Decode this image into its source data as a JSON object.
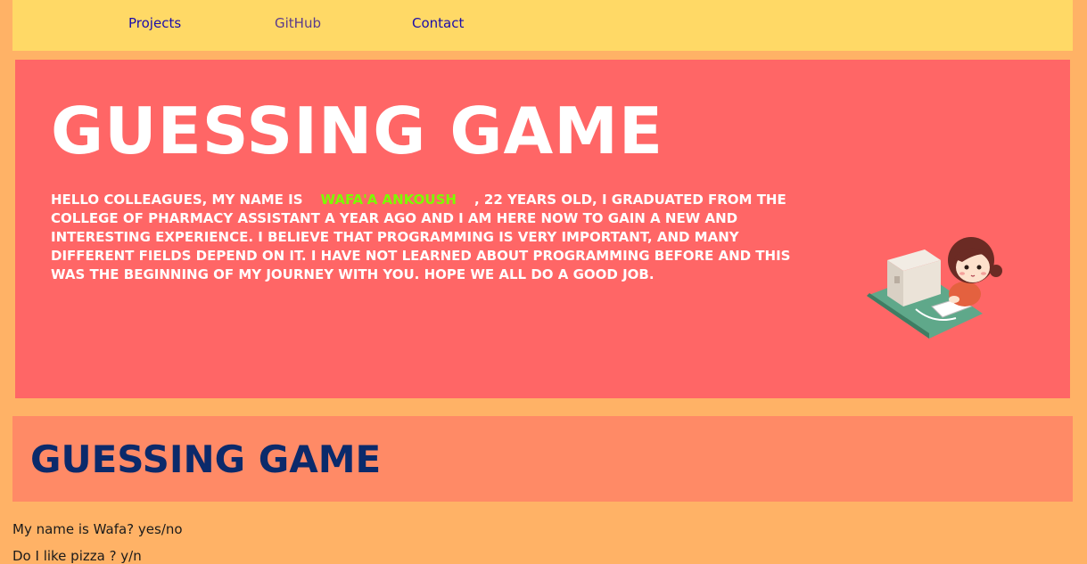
{
  "nav": {
    "links": [
      {
        "label": "Projects"
      },
      {
        "label": "GitHub"
      },
      {
        "label": "Contact"
      }
    ]
  },
  "hero": {
    "title": "GUESSING GAME",
    "intro_before": "Hello colleagues, my name is",
    "name": "Wafa'a Ankoush",
    "intro_after": ", 22 years old, I graduated from the College of Pharmacy Assistant a year ago and I am here now to gain a new and interesting experience. I believe that programming is very important, and many different fields depend on it. I have not learned about programming before and this was the beginning of my journey with you. Hope we all do a good job.",
    "illustration": "girl-at-computer-illustration"
  },
  "section": {
    "title": "GUESSING GAME"
  },
  "questions": [
    {
      "text": "My name is Wafa? yes/no"
    },
    {
      "text": "Do I like pizza ? y/n"
    }
  ],
  "colors": {
    "page_bg": "#FFB266",
    "nav_bg": "#FFD966",
    "hero_bg": "#FF6666",
    "section_bg": "#FF8A66",
    "name_highlight": "#7CFC00",
    "section_title": "#0B2A6B"
  }
}
